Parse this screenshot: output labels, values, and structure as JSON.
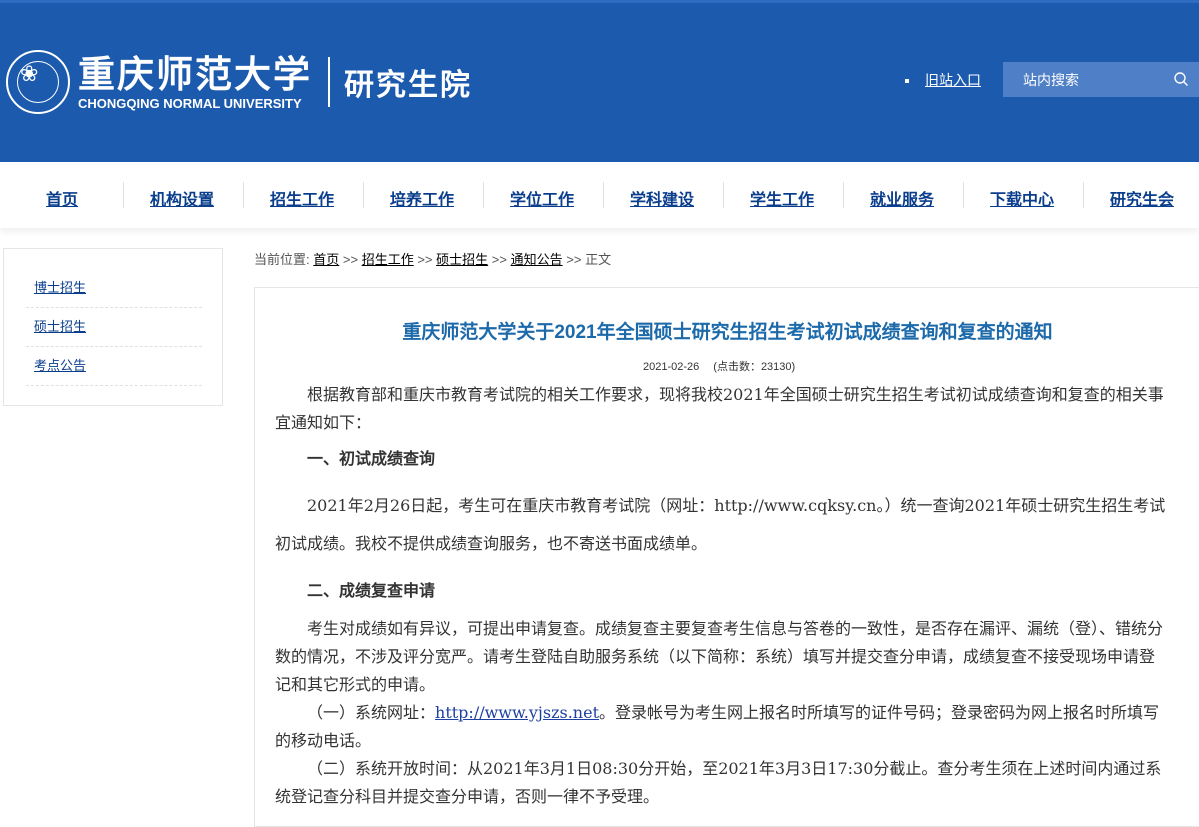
{
  "header": {
    "school_cn": "重庆师范大学",
    "school_en": "CHONGQING NORMAL UNIVERSITY",
    "dept": "研究生院",
    "old_site": "旧站入口",
    "search_placeholder": "站内搜索"
  },
  "nav": [
    "首页",
    "机构设置",
    "招生工作",
    "培养工作",
    "学位工作",
    "学科建设",
    "学生工作",
    "就业服务",
    "下载中心",
    "研究生会"
  ],
  "sidebar": [
    "博士招生",
    "硕士招生",
    "考点公告"
  ],
  "breadcrumb": {
    "prefix": "当前位置:",
    "items": [
      "首页",
      "招生工作",
      "硕士招生",
      "通知公告"
    ],
    "sep": ">>",
    "current": "正文"
  },
  "article": {
    "title": "重庆师范大学关于2021年全国硕士研究生招生考试初试成绩查询和复查的通知",
    "date": "2021-02-26",
    "views": "(点击数：23130)",
    "p1": "根据教育部和重庆市教育考试院的相关工作要求，现将我校2021年全国硕士研究生招生考试初试成绩查询和复查的相关事宜通知如下：",
    "h1": "一、初试成绩查询",
    "p2": "2021年2月26日起，考生可在重庆市教育考试院（网址：http://www.cqksy.cn。）统一查询2021年硕士研究生招生考试初试成绩。我校不提供成绩查询服务，也不寄送书面成绩单。",
    "h2": "二、成绩复查申请",
    "p3": "考生对成绩如有异议，可提出申请复查。成绩复查主要复查考生信息与答卷的一致性，是否存在漏评、漏统（登）、错统分数的情况，不涉及评分宽严。请考生登陆自助服务系统（以下简称：系统）填写并提交查分申请，成绩复查不接受现场申请登记和其它形式的申请。",
    "p4_pre": "（一）系统网址：",
    "p4_link": "http://www.yjszs.net",
    "p4_post": "。登录帐号为考生网上报名时所填写的证件号码；登录密码为网上报名时所填写的移动电话。",
    "p5": "（二）系统开放时间：从2021年3月1日08:30分开始，至2021年3月3日17:30分截止。查分考生须在上述时间内通过系统登记查分科目并提交查分申请，否则一律不予受理。"
  },
  "colors": {
    "header_bg": "#1c5aae",
    "title_blue": "#1d6aab",
    "nav_text": "#0a3e8c"
  }
}
